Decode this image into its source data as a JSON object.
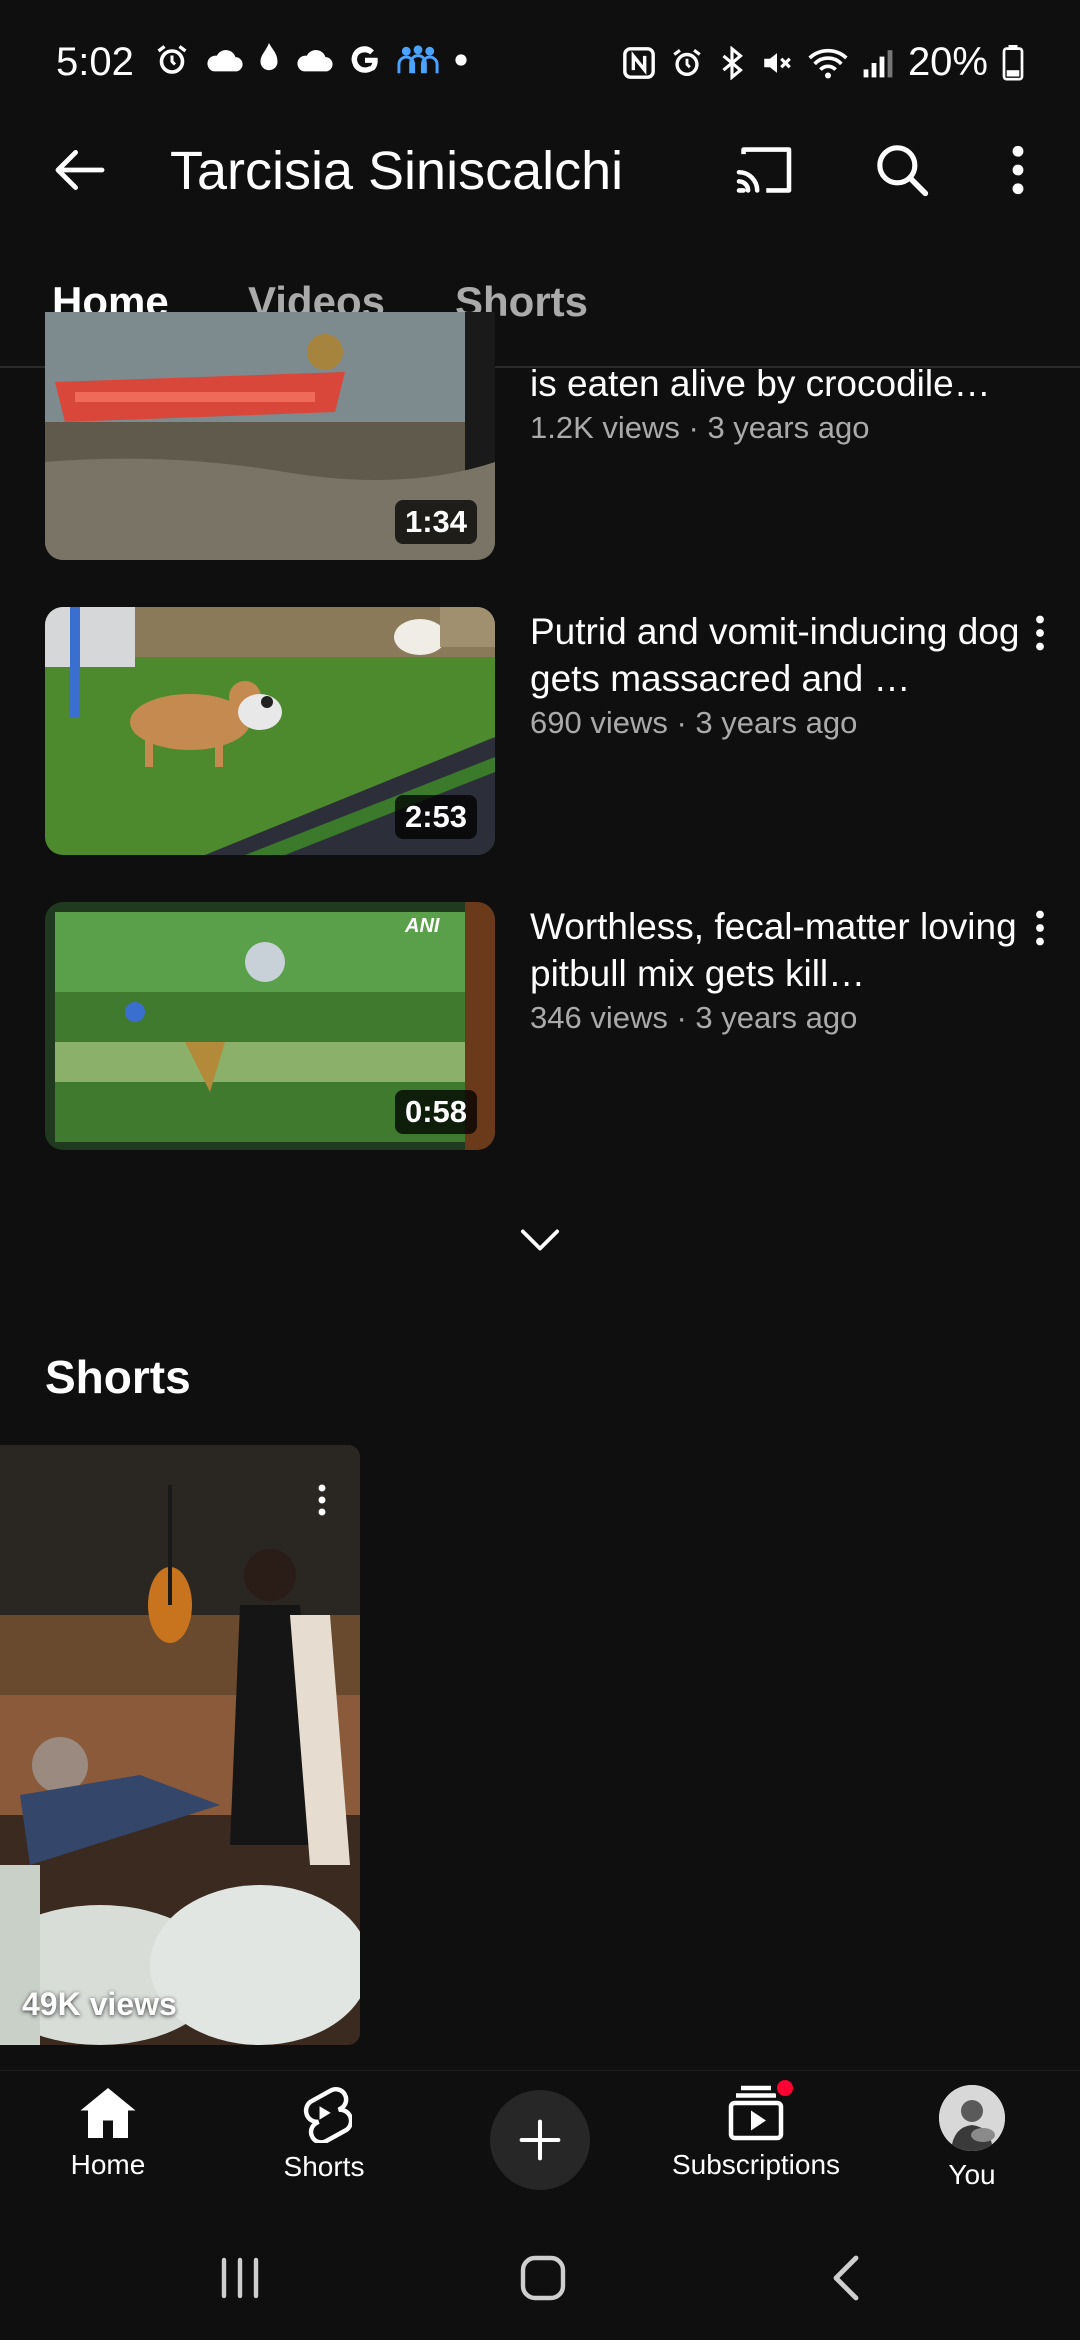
{
  "status_bar": {
    "time": "5:02",
    "battery_percent": "20%"
  },
  "app_bar": {
    "title": "Tarcisia Siniscalchi"
  },
  "tabs": [
    {
      "label": "Home",
      "active": true
    },
    {
      "label": "Videos",
      "active": false
    },
    {
      "label": "Shorts",
      "active": false
    }
  ],
  "videos": [
    {
      "title": "is eaten alive by crocodile…",
      "meta": "1.2K views · 3 years ago",
      "duration": "1:34"
    },
    {
      "title": "Putrid and vomit-inducing dog gets massacred and …",
      "meta": "690 views · 3 years ago",
      "duration": "2:53"
    },
    {
      "title": "Worthless, fecal-matter loving pitbull mix gets kill…",
      "meta": "346 views · 3 years ago",
      "duration": "0:58"
    }
  ],
  "shorts_section": {
    "heading": "Shorts",
    "items": [
      {
        "views": "49K views"
      }
    ]
  },
  "bottom_nav": {
    "home": "Home",
    "shorts": "Shorts",
    "subscriptions": "Subscriptions",
    "you": "You"
  },
  "colors": {
    "background": "#0f0f0f",
    "text_secondary": "#aaaaaa",
    "notification": "#ff0033"
  }
}
